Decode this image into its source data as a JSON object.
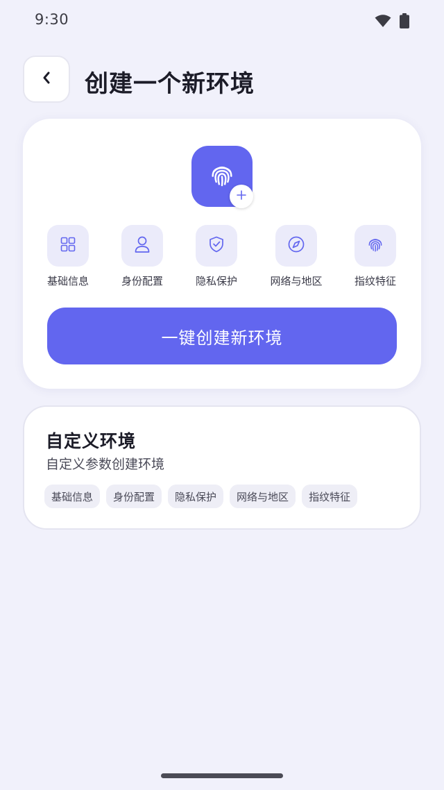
{
  "status_bar": {
    "time": "9:30",
    "icons": [
      "wifi-icon",
      "battery-icon"
    ]
  },
  "header": {
    "back_icon": "chevron-left-icon",
    "title": "创建一个新环境"
  },
  "quick_card": {
    "hero_icon": "fingerprint-icon",
    "hero_badge_icon": "plus-icon",
    "features": [
      {
        "icon": "grid-icon",
        "label": "基础信息"
      },
      {
        "icon": "user-icon",
        "label": "身份配置"
      },
      {
        "icon": "shield-check-icon",
        "label": "隐私保护"
      },
      {
        "icon": "compass-icon",
        "label": "网络与地区"
      },
      {
        "icon": "fingerprint-icon",
        "label": "指纹特征"
      }
    ],
    "create_button_label": "一键创建新环境"
  },
  "custom_card": {
    "title": "自定义环境",
    "subtitle": "自定义参数创建环境",
    "tags": [
      "基础信息",
      "身份配置",
      "隐私保护",
      "网络与地区",
      "指纹特征"
    ]
  },
  "colors": {
    "accent": "#6266ef",
    "background": "#f1f1fb",
    "card": "#ffffff",
    "feature_tile": "#ebebfa",
    "tag_bg": "#eeeef6"
  }
}
